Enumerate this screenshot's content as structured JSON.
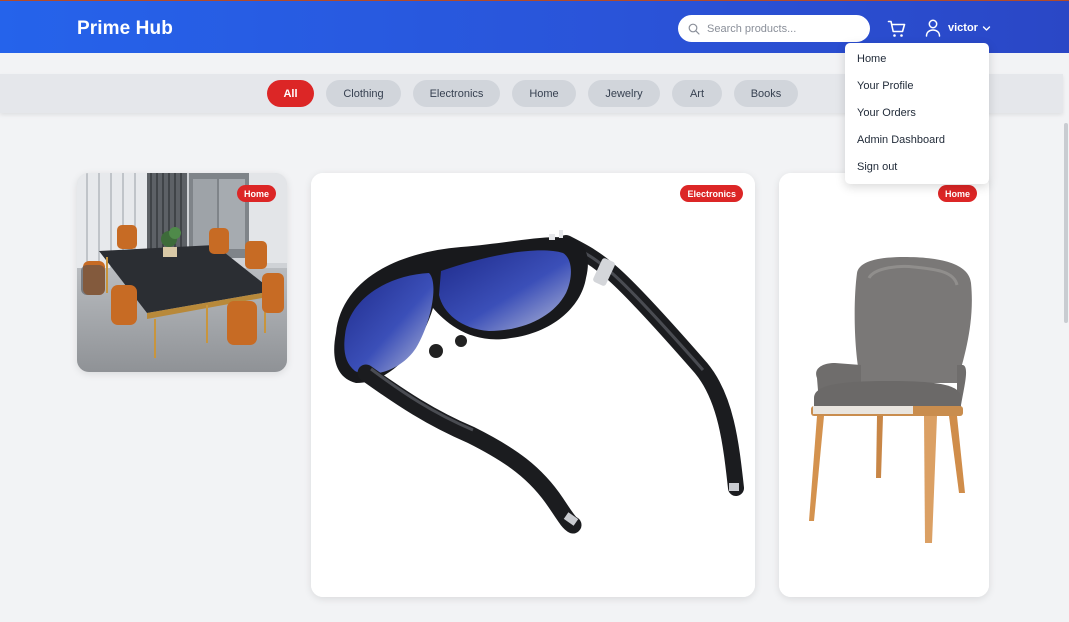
{
  "header": {
    "brand": "Prime Hub",
    "search_placeholder": "Search products...",
    "username": "victor"
  },
  "categories": [
    {
      "label": "All",
      "active": true
    },
    {
      "label": "Clothing",
      "active": false
    },
    {
      "label": "Electronics",
      "active": false
    },
    {
      "label": "Home",
      "active": false
    },
    {
      "label": "Jewelry",
      "active": false
    },
    {
      "label": "Art",
      "active": false
    },
    {
      "label": "Books",
      "active": false
    }
  ],
  "products": [
    {
      "badge": "Home",
      "image": "dining-table-photo"
    },
    {
      "badge": "Electronics",
      "image": "smart-glasses-photo"
    },
    {
      "badge": "Home",
      "image": "armchair-photo"
    }
  ],
  "user_menu": {
    "items": [
      "Home",
      "Your Profile",
      "Your Orders",
      "Admin Dashboard",
      "Sign out"
    ]
  },
  "colors": {
    "header_gradient_start": "#2563eb",
    "header_gradient_end": "#2a47c6",
    "accent_red": "#dc2626",
    "chip_gray": "#d1d5db",
    "page_bg": "#f2f3f5"
  }
}
